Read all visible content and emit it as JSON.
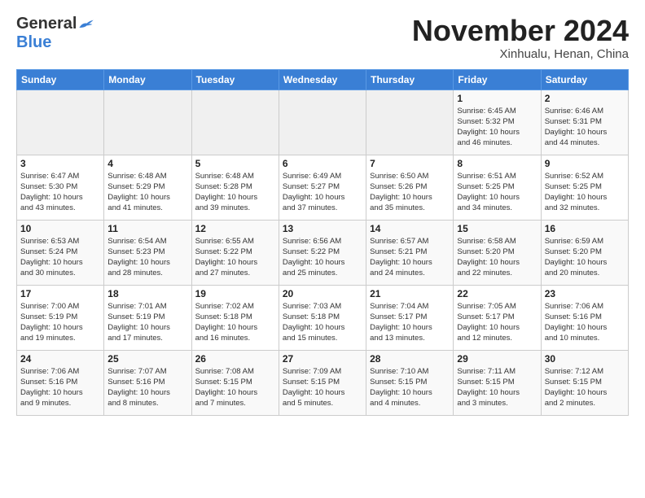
{
  "header": {
    "logo_general": "General",
    "logo_blue": "Blue",
    "month_title": "November 2024",
    "subtitle": "Xinhualu, Henan, China"
  },
  "days_of_week": [
    "Sunday",
    "Monday",
    "Tuesday",
    "Wednesday",
    "Thursday",
    "Friday",
    "Saturday"
  ],
  "weeks": [
    [
      {
        "day": "",
        "info": ""
      },
      {
        "day": "",
        "info": ""
      },
      {
        "day": "",
        "info": ""
      },
      {
        "day": "",
        "info": ""
      },
      {
        "day": "",
        "info": ""
      },
      {
        "day": "1",
        "info": "Sunrise: 6:45 AM\nSunset: 5:32 PM\nDaylight: 10 hours\nand 46 minutes."
      },
      {
        "day": "2",
        "info": "Sunrise: 6:46 AM\nSunset: 5:31 PM\nDaylight: 10 hours\nand 44 minutes."
      }
    ],
    [
      {
        "day": "3",
        "info": "Sunrise: 6:47 AM\nSunset: 5:30 PM\nDaylight: 10 hours\nand 43 minutes."
      },
      {
        "day": "4",
        "info": "Sunrise: 6:48 AM\nSunset: 5:29 PM\nDaylight: 10 hours\nand 41 minutes."
      },
      {
        "day": "5",
        "info": "Sunrise: 6:48 AM\nSunset: 5:28 PM\nDaylight: 10 hours\nand 39 minutes."
      },
      {
        "day": "6",
        "info": "Sunrise: 6:49 AM\nSunset: 5:27 PM\nDaylight: 10 hours\nand 37 minutes."
      },
      {
        "day": "7",
        "info": "Sunrise: 6:50 AM\nSunset: 5:26 PM\nDaylight: 10 hours\nand 35 minutes."
      },
      {
        "day": "8",
        "info": "Sunrise: 6:51 AM\nSunset: 5:25 PM\nDaylight: 10 hours\nand 34 minutes."
      },
      {
        "day": "9",
        "info": "Sunrise: 6:52 AM\nSunset: 5:25 PM\nDaylight: 10 hours\nand 32 minutes."
      }
    ],
    [
      {
        "day": "10",
        "info": "Sunrise: 6:53 AM\nSunset: 5:24 PM\nDaylight: 10 hours\nand 30 minutes."
      },
      {
        "day": "11",
        "info": "Sunrise: 6:54 AM\nSunset: 5:23 PM\nDaylight: 10 hours\nand 28 minutes."
      },
      {
        "day": "12",
        "info": "Sunrise: 6:55 AM\nSunset: 5:22 PM\nDaylight: 10 hours\nand 27 minutes."
      },
      {
        "day": "13",
        "info": "Sunrise: 6:56 AM\nSunset: 5:22 PM\nDaylight: 10 hours\nand 25 minutes."
      },
      {
        "day": "14",
        "info": "Sunrise: 6:57 AM\nSunset: 5:21 PM\nDaylight: 10 hours\nand 24 minutes."
      },
      {
        "day": "15",
        "info": "Sunrise: 6:58 AM\nSunset: 5:20 PM\nDaylight: 10 hours\nand 22 minutes."
      },
      {
        "day": "16",
        "info": "Sunrise: 6:59 AM\nSunset: 5:20 PM\nDaylight: 10 hours\nand 20 minutes."
      }
    ],
    [
      {
        "day": "17",
        "info": "Sunrise: 7:00 AM\nSunset: 5:19 PM\nDaylight: 10 hours\nand 19 minutes."
      },
      {
        "day": "18",
        "info": "Sunrise: 7:01 AM\nSunset: 5:19 PM\nDaylight: 10 hours\nand 17 minutes."
      },
      {
        "day": "19",
        "info": "Sunrise: 7:02 AM\nSunset: 5:18 PM\nDaylight: 10 hours\nand 16 minutes."
      },
      {
        "day": "20",
        "info": "Sunrise: 7:03 AM\nSunset: 5:18 PM\nDaylight: 10 hours\nand 15 minutes."
      },
      {
        "day": "21",
        "info": "Sunrise: 7:04 AM\nSunset: 5:17 PM\nDaylight: 10 hours\nand 13 minutes."
      },
      {
        "day": "22",
        "info": "Sunrise: 7:05 AM\nSunset: 5:17 PM\nDaylight: 10 hours\nand 12 minutes."
      },
      {
        "day": "23",
        "info": "Sunrise: 7:06 AM\nSunset: 5:16 PM\nDaylight: 10 hours\nand 10 minutes."
      }
    ],
    [
      {
        "day": "24",
        "info": "Sunrise: 7:06 AM\nSunset: 5:16 PM\nDaylight: 10 hours\nand 9 minutes."
      },
      {
        "day": "25",
        "info": "Sunrise: 7:07 AM\nSunset: 5:16 PM\nDaylight: 10 hours\nand 8 minutes."
      },
      {
        "day": "26",
        "info": "Sunrise: 7:08 AM\nSunset: 5:15 PM\nDaylight: 10 hours\nand 7 minutes."
      },
      {
        "day": "27",
        "info": "Sunrise: 7:09 AM\nSunset: 5:15 PM\nDaylight: 10 hours\nand 5 minutes."
      },
      {
        "day": "28",
        "info": "Sunrise: 7:10 AM\nSunset: 5:15 PM\nDaylight: 10 hours\nand 4 minutes."
      },
      {
        "day": "29",
        "info": "Sunrise: 7:11 AM\nSunset: 5:15 PM\nDaylight: 10 hours\nand 3 minutes."
      },
      {
        "day": "30",
        "info": "Sunrise: 7:12 AM\nSunset: 5:15 PM\nDaylight: 10 hours\nand 2 minutes."
      }
    ]
  ]
}
